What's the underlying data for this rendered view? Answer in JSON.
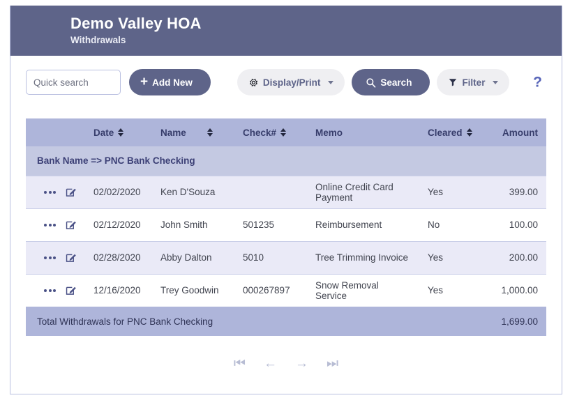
{
  "header": {
    "title": "Demo Valley HOA",
    "subtitle": "Withdrawals"
  },
  "toolbar": {
    "search_placeholder": "Quick search",
    "search_value": "",
    "search_icon": "magnifier-icon",
    "add_new_label": "Add New",
    "add_new_icon": "plus-icon",
    "display_print_label": "Display/Print",
    "display_print_icon": "gear-icon",
    "search_button_label": "Search",
    "search_button_icon": "magnifier-icon",
    "filter_label": "Filter",
    "filter_icon": "funnel-icon",
    "help_label": "?"
  },
  "table": {
    "columns": [
      {
        "label": "",
        "sortable": false,
        "align": "left"
      },
      {
        "label": "Date",
        "sortable": true,
        "align": "left"
      },
      {
        "label": "Name",
        "sortable": true,
        "align": "left"
      },
      {
        "label": "Check#",
        "sortable": true,
        "align": "left"
      },
      {
        "label": "Memo",
        "sortable": false,
        "align": "left"
      },
      {
        "label": "Cleared",
        "sortable": true,
        "align": "left"
      },
      {
        "label": "Amount",
        "sortable": false,
        "align": "right"
      }
    ],
    "group_label": "Bank Name => PNC Bank Checking",
    "rows": [
      {
        "date": "02/02/2020",
        "name": "Ken D'Souza",
        "check": "",
        "memo": "Online Credit Card Payment",
        "cleared": "Yes",
        "amount": "399.00"
      },
      {
        "date": "02/12/2020",
        "name": "John Smith",
        "check": "501235",
        "memo": "Reimbursement",
        "cleared": "No",
        "amount": "100.00"
      },
      {
        "date": "02/28/2020",
        "name": "Abby Dalton",
        "check": "5010",
        "memo": "Tree Trimming Invoice",
        "cleared": "Yes",
        "amount": "200.00"
      },
      {
        "date": "12/16/2020",
        "name": "Trey Goodwin",
        "check": "000267897",
        "memo": "Snow Removal Service",
        "cleared": "Yes",
        "amount": "1,000.00"
      }
    ],
    "total_label": "Total Withdrawals for PNC Bank Checking",
    "total_amount": "1,699.00",
    "row_action_icons": [
      "ellipsis-icon",
      "edit-icon"
    ]
  },
  "pager": {
    "first": "⏮",
    "prev": "←",
    "next": "→",
    "last": "⏭"
  },
  "colors": {
    "header_bar": "#5e6489",
    "accent": "#5e6489",
    "table_header": "#aeb5da",
    "group_row": "#c4c9e2",
    "row_odd": "#eaeaf7",
    "help": "#5764b8"
  }
}
